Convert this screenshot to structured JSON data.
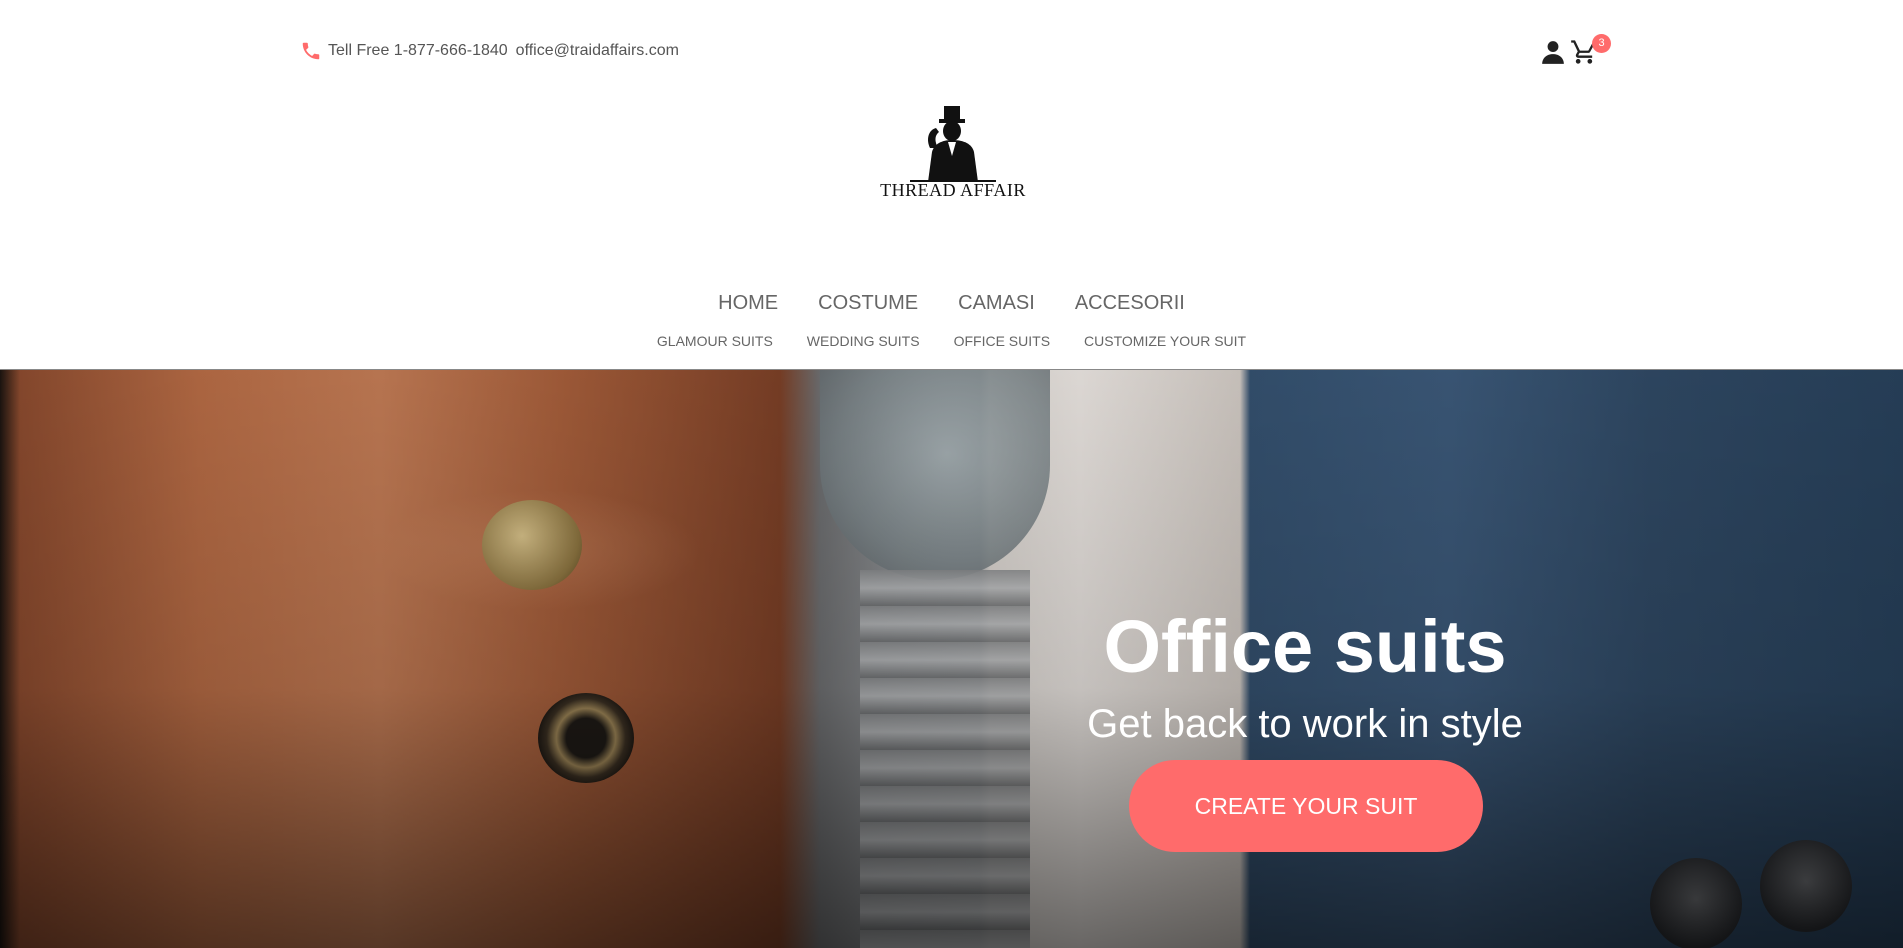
{
  "contact": {
    "phone": "Tell Free 1-877-666-1840",
    "email": "office@traidaffairs.com"
  },
  "cart": {
    "count": "3"
  },
  "brand": {
    "logo_text": "THREAD AFFAIR"
  },
  "nav": {
    "main": [
      "HOME",
      "COSTUME",
      "CAMASI",
      "ACCESORII"
    ],
    "sub": [
      "GLAMOUR SUITS",
      "WEDDING SUITS",
      "OFFICE SUITS",
      "CUSTOMIZE YOUR SUIT"
    ]
  },
  "hero": {
    "title": "Office suits",
    "subtitle": "Get back to work in style",
    "cta_label": "CREATE YOUR SUIT"
  },
  "colors": {
    "accent": "#ff6b6b",
    "text": "#555555"
  },
  "icons": [
    "phone-icon",
    "user-icon",
    "cart-icon"
  ]
}
